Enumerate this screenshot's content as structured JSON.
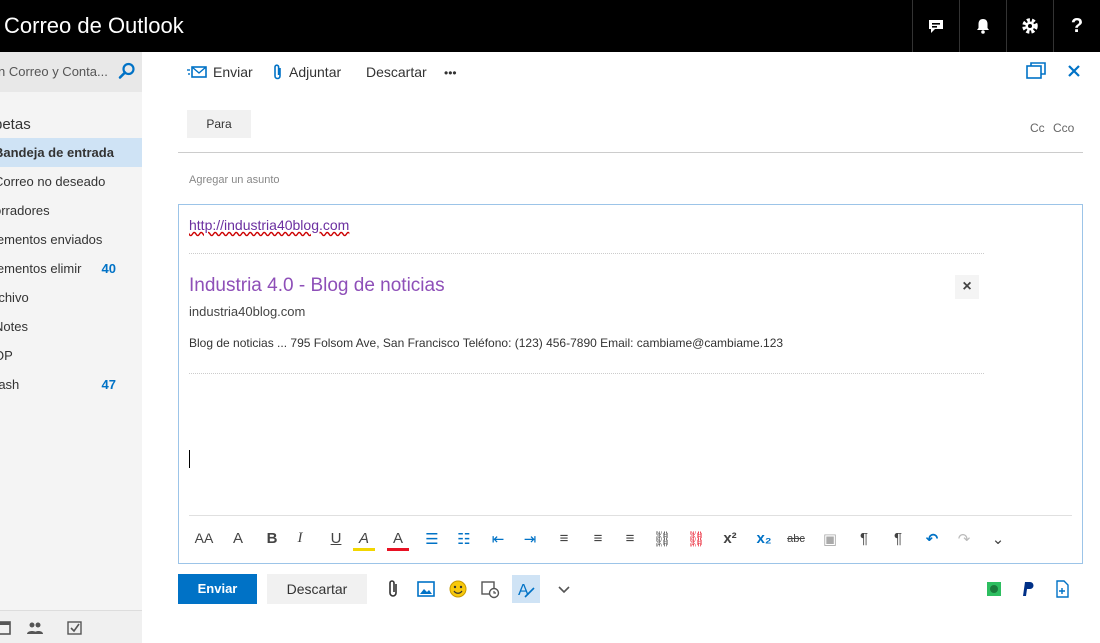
{
  "app": {
    "title": "Correo de Outlook"
  },
  "top_icons": [
    "feedback-icon",
    "bell-icon",
    "gear-icon",
    "help-icon"
  ],
  "help_label": "?",
  "sidebar": {
    "search_placeholder": "n Correo y Conta...",
    "folders_heading": "petas",
    "folders": [
      {
        "label": "Bandeja de entrada",
        "count": "",
        "selected": true
      },
      {
        "label": "Correo no deseado",
        "count": ""
      },
      {
        "label": "orradores",
        "count": ""
      },
      {
        "label": "lementos enviados",
        "count": ""
      },
      {
        "label": "lementos elimir",
        "count": "40"
      },
      {
        "label": "rchivo",
        "count": ""
      },
      {
        "label": "Notes",
        "count": ""
      },
      {
        "label": "OP",
        "count": ""
      },
      {
        "label": "rash",
        "count": "47"
      }
    ]
  },
  "toolbar": {
    "send": "Enviar",
    "attach": "Adjuntar",
    "discard": "Descartar",
    "more": "•••"
  },
  "compose": {
    "to_label": "Para",
    "cc": "Cc",
    "bcc": "Cco",
    "subject_placeholder": "Agregar un asunto",
    "link": "http://industria40blog.com",
    "card_title": "Industria 4.0 - Blog de noticias",
    "card_domain": "industria40blog.com",
    "card_desc": "Blog de noticias ... 795 Folsom Ave, San Francisco Teléfono: (123) 456-7890 Email: cambiame@cambiame.123",
    "card_close": "×"
  },
  "format_bar": [
    "AA",
    "A",
    "B",
    "I",
    "U",
    "A",
    "A",
    "☰",
    "☷",
    "⇤",
    "⇥",
    "≡",
    "≡",
    "≡",
    "⛓",
    "⛓",
    "x²",
    "x₂",
    "abc",
    "▣",
    "¶",
    "¶",
    "↶",
    "↷",
    "⌄"
  ],
  "bottom": {
    "send": "Enviar",
    "discard": "Descartar"
  },
  "colors": {
    "accent": "#0072c6",
    "topbar": "#000000",
    "link_purple": "#8e4fb8"
  }
}
